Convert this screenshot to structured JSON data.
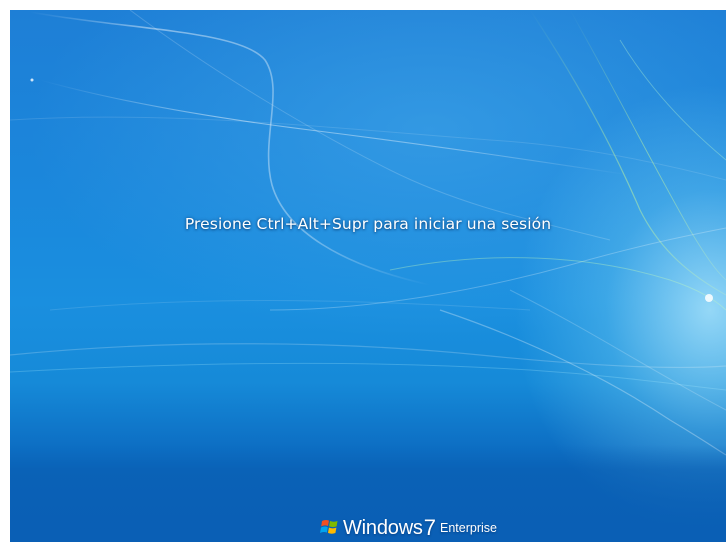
{
  "login_screen": {
    "prompt": "Presione Ctrl+Alt+Supr para iniciar una sesión"
  },
  "branding": {
    "logo_icon": "windows-flag-icon",
    "product_name": "Windows",
    "version": "7",
    "edition": "Enterprise"
  },
  "colors": {
    "background_top": "#1e7fd6",
    "background_bottom": "#0a63b8",
    "text": "#ffffff",
    "logo_red": "#f25022",
    "logo_green": "#7fba00",
    "logo_blue": "#00a4ef",
    "logo_yellow": "#ffb900"
  }
}
